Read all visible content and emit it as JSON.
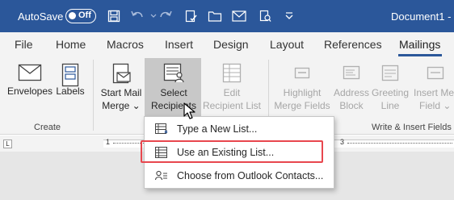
{
  "titlebar": {
    "autosave_label": "AutoSave",
    "toggle_state": "Off",
    "document_title": "Document1",
    "separator": "-",
    "brand_color": "#2b579a"
  },
  "tabs": [
    {
      "label": "File"
    },
    {
      "label": "Home"
    },
    {
      "label": "Macros"
    },
    {
      "label": "Insert"
    },
    {
      "label": "Design"
    },
    {
      "label": "Layout"
    },
    {
      "label": "References"
    },
    {
      "label": "Mailings",
      "active": true
    }
  ],
  "ribbon": {
    "create_group": {
      "label": "Create",
      "buttons": [
        {
          "label": "Envelopes",
          "icon": "envelope-icon"
        },
        {
          "label": "Labels",
          "icon": "labels-icon"
        }
      ]
    },
    "start_group": {
      "buttons": [
        {
          "line1": "Start Mail",
          "line2": "Merge",
          "caret": "⌄",
          "icon": "start-mail-merge-icon"
        },
        {
          "line1": "Select",
          "line2": "Recipients",
          "caret": "⌄",
          "icon": "select-recipients-icon"
        },
        {
          "line1": "Edit",
          "line2": "Recipient List",
          "icon": "edit-recipient-list-icon",
          "disabled": true
        }
      ]
    },
    "write_insert_group": {
      "label": "Write & Insert Fields",
      "buttons": [
        {
          "line1": "Highlight",
          "line2": "Merge Fields",
          "icon": "highlight-merge-fields-icon",
          "disabled": true
        },
        {
          "line1": "Address",
          "line2": "Block",
          "icon": "address-block-icon",
          "disabled": true
        },
        {
          "line1": "Greeting",
          "line2": "Line",
          "icon": "greeting-line-icon",
          "disabled": true
        },
        {
          "line1": "Insert Merge",
          "line2": "Field",
          "caret": "⌄",
          "icon": "insert-merge-field-icon",
          "disabled": true
        }
      ]
    }
  },
  "ruler": {
    "corner_glyph": "L",
    "numbers": [
      "1",
      "3"
    ]
  },
  "dropdown": {
    "items": [
      {
        "label": "Type a New List...",
        "icon": "new-list-icon"
      },
      {
        "label": "Use an Existing List...",
        "icon": "existing-list-icon",
        "highlighted": true
      },
      {
        "label": "Choose from Outlook Contacts...",
        "icon": "outlook-contacts-icon"
      }
    ],
    "highlight_color": "#e8474e"
  }
}
